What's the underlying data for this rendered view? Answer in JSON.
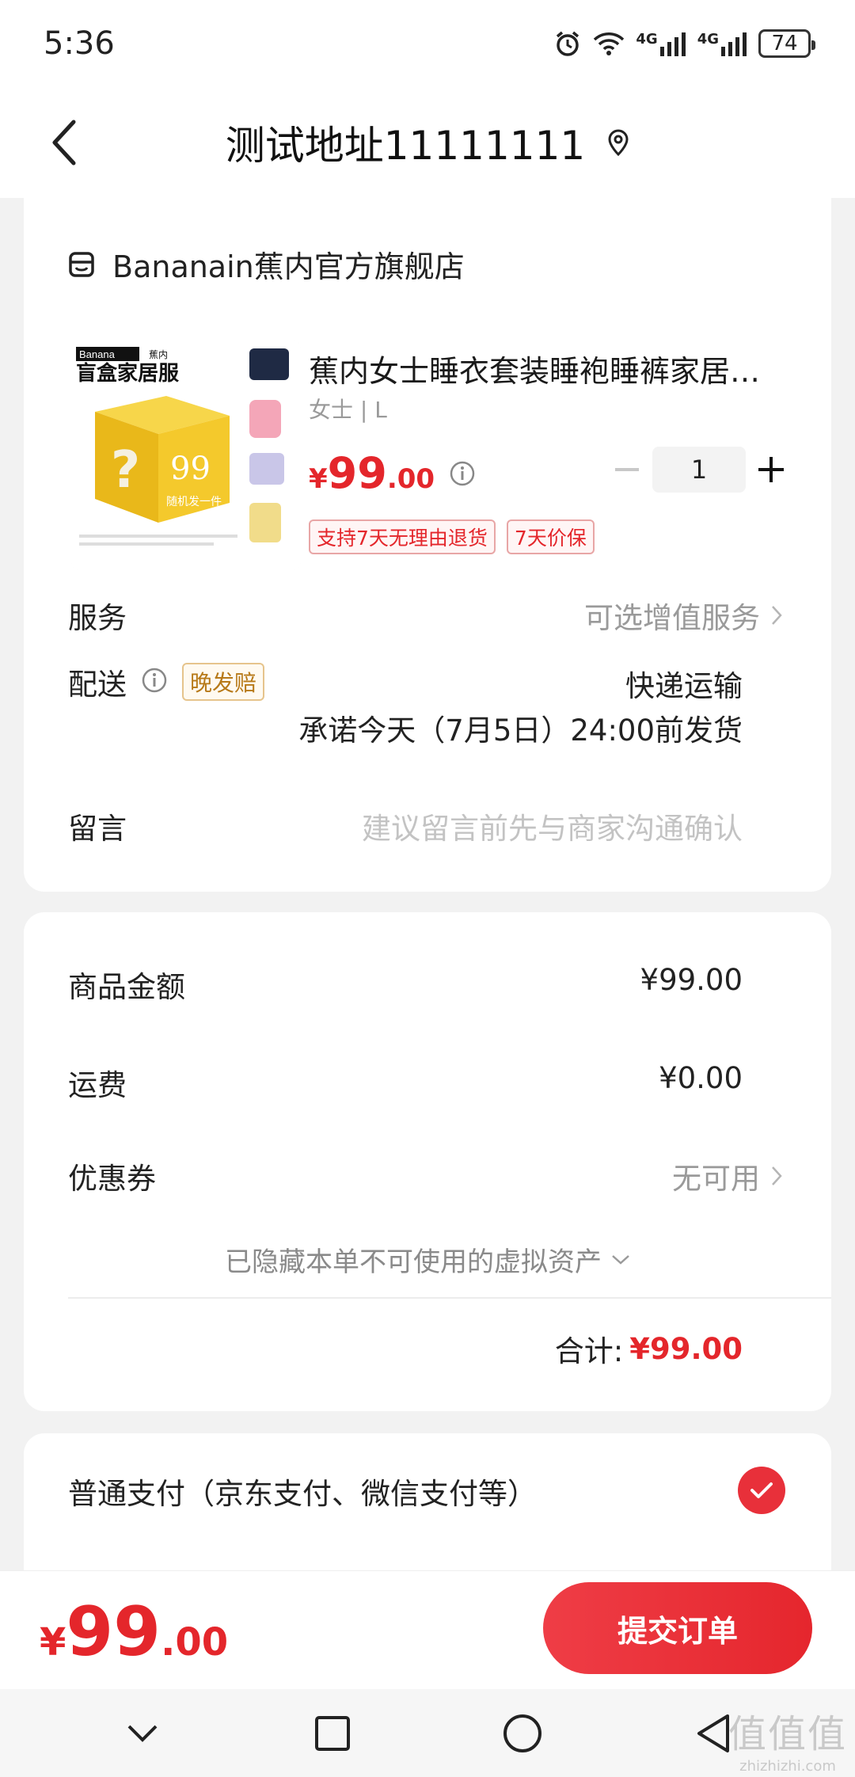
{
  "status_bar": {
    "time": "5:36",
    "network_1": "4G",
    "network_2": "4G",
    "battery": "74"
  },
  "header": {
    "title": "测试地址11111111"
  },
  "order": {
    "store_name": "Bananain蕉内官方旗舰店",
    "product": {
      "title": "蕉内女士睡衣套装睡袍睡裤家居…",
      "spec": "女士 | L",
      "price_symbol": "¥",
      "price_int": "99",
      "price_dec": ".00",
      "quantity": "1",
      "tags": [
        "支持7天无理由退货",
        "7天价保"
      ],
      "image_text": {
        "brand": "Banana",
        "brand2": "蕉内",
        "headline": "盲盒家居服",
        "cube_price": "99",
        "cube_sub": "随机发一件"
      }
    },
    "service": {
      "label": "服务",
      "value": "可选增值服务"
    },
    "delivery": {
      "label": "配送",
      "badge": "晚发赔",
      "method": "快递运输",
      "promise": "承诺今天（7月5日）24:00前发货"
    },
    "message": {
      "label": "留言",
      "placeholder": "建议留言前先与商家沟通确认"
    }
  },
  "summary": {
    "goods_label": "商品金额",
    "goods_value": "¥99.00",
    "shipping_label": "运费",
    "shipping_value": "¥0.00",
    "coupon_label": "优惠券",
    "coupon_value": "无可用",
    "hidden_assets": "已隐藏本单不可使用的虚拟资产",
    "total_label": "合计:",
    "total_value": "¥99.00"
  },
  "payment": {
    "method": "普通支付（京东支付、微信支付等）"
  },
  "bottom_bar": {
    "price_symbol": "¥",
    "price_int": "99",
    "price_dec": ".00",
    "submit_label": "提交订单"
  },
  "watermark": {
    "big": "值值值",
    "small": "zhizhizhi.com"
  },
  "colors": {
    "accent": "#e4262b",
    "background": "#f2f2f2"
  }
}
